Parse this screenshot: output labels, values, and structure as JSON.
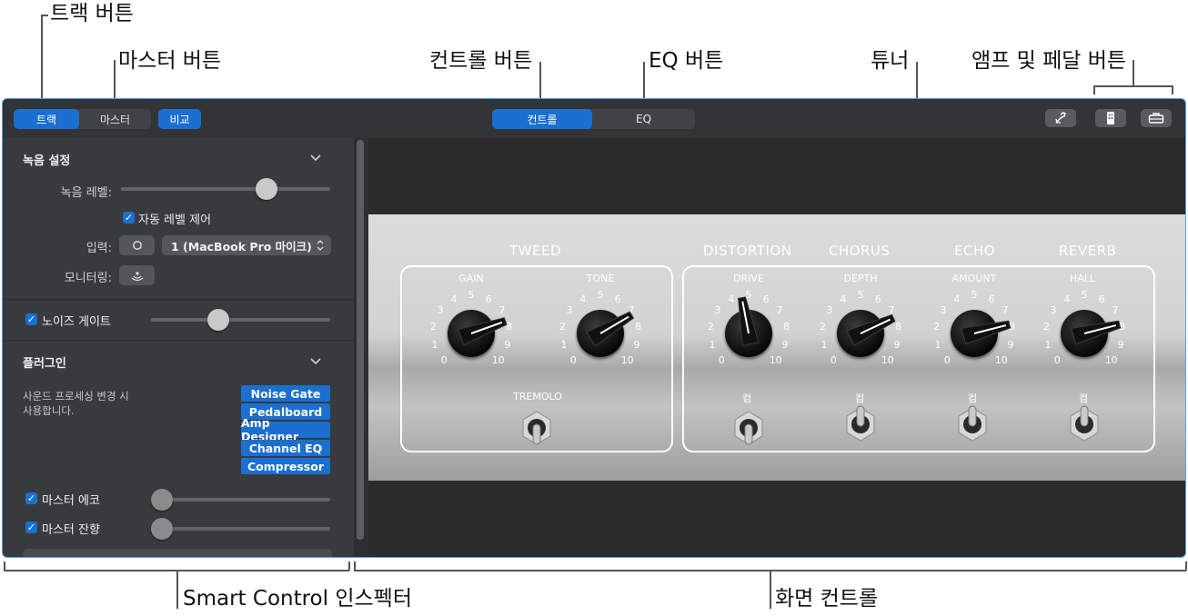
{
  "callouts": {
    "track_button": "트랙 버튼",
    "master_button": "마스터 버튼",
    "controls_button": "컨트롤 버튼",
    "eq_button": "EQ 버튼",
    "tuner": "튜너",
    "amp_pedal_button": "앰프 및 페달 버튼",
    "smart_control_inspector": "Smart Control 인스펙터",
    "screen_controls": "화면 컨트롤"
  },
  "toolbar": {
    "left_segment": [
      "트랙",
      "마스터"
    ],
    "compare": "비교",
    "center_segment": [
      "컨트롤",
      "EQ"
    ]
  },
  "inspector": {
    "recording_settings": "녹음 설정",
    "record_level_label": "녹음 레벨:",
    "record_level": 0.72,
    "auto_level_label": "자동 레벨 제어",
    "input_label": "입력:",
    "input_value": "1 (MacBook Pro 마이크)",
    "monitoring_label": "모니터링:",
    "noise_gate_label": "노이즈 게이트",
    "noise_gate_level": 0.36,
    "plugins_header": "플러그인",
    "plugins_desc_1": "사운드 프로세싱 변경 시",
    "plugins_desc_2": "사용합니다.",
    "plugins": [
      "Noise Gate",
      "Pedalboard",
      "Amp Designer",
      "Channel EQ",
      "Compressor"
    ],
    "master_echo_label": "마스터 에코",
    "master_echo_level": 0,
    "master_reverb_label": "마스터 잔향",
    "master_reverb_level": 0
  },
  "amp": {
    "sections": {
      "tweed": "TWEED",
      "distortion": "DISTORTION",
      "chorus": "CHORUS",
      "echo": "ECHO",
      "reverb": "REVERB"
    },
    "knob_labels": {
      "gain": "GAIN",
      "tone": "TONE",
      "drive": "DRIVE",
      "depth": "DEPTH",
      "amount": "AMOUNT",
      "hall": "HALL"
    },
    "knob_values": {
      "gain": 7.6,
      "tone": 7.2,
      "drive": 4.6,
      "depth": 7.4,
      "amount": 7.8,
      "hall": 7.8
    },
    "tremolo": "TREMOLO",
    "on_label": "컴"
  }
}
